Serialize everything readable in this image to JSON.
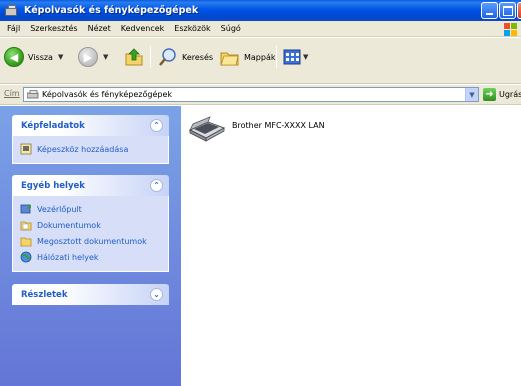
{
  "window": {
    "title": "Képolvasók és fényképezőgépek"
  },
  "menu": {
    "items": [
      "Fájl",
      "Szerkesztés",
      "Nézet",
      "Kedvencek",
      "Eszközök",
      "Súgó"
    ]
  },
  "toolbar": {
    "back_label": "Vissza",
    "search_label": "Keresés",
    "folders_label": "Mappák"
  },
  "address": {
    "label": "Cím",
    "value": "Képolvasók és fényképezőgépek",
    "go_label": "Ugrás"
  },
  "taskpane": {
    "panels": [
      {
        "title": "Képfeladatok",
        "items": [
          {
            "label": "Képeszköz hozzáadása",
            "icon": "add-device-icon"
          }
        ]
      },
      {
        "title": "Egyéb helyek",
        "items": [
          {
            "label": "Vezérlőpult",
            "icon": "control-panel-icon"
          },
          {
            "label": "Dokumentumok",
            "icon": "documents-folder-icon"
          },
          {
            "label": "Megosztott dokumentumok",
            "icon": "shared-folder-icon"
          },
          {
            "label": "Hálózati helyek",
            "icon": "network-places-icon"
          }
        ]
      },
      {
        "title": "Részletek",
        "items": []
      }
    ]
  },
  "content": {
    "device_label": "Brother MFC-XXXX   LAN"
  },
  "colors": {
    "titlebar": "#0055e5",
    "taskpane_top": "#7ba2e7",
    "taskpane_bottom": "#6375d6",
    "link": "#215dc6"
  }
}
